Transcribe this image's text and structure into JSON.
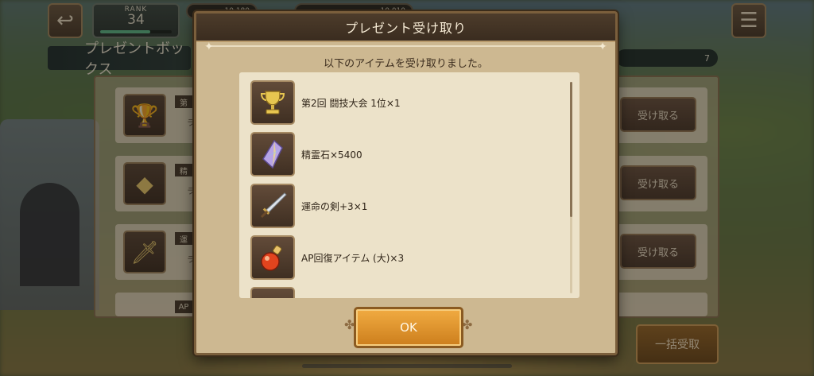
{
  "hud": {
    "back_icon": "return-arrow-icon",
    "rank_label": "RANK",
    "rank_value": "34",
    "res1": "10,180",
    "res2": "10,010",
    "menu_icon": "hamburger-menu-icon"
  },
  "panel": {
    "title": "プレゼントボックス",
    "count": "7",
    "rows": [
      {
        "tag": "第",
        "sub": "ラ",
        "button": "受け取る",
        "icon": "trophy-icon"
      },
      {
        "tag": "精",
        "sub": "ラ",
        "button": "受け取る",
        "icon": "crystal-icon"
      },
      {
        "tag": "運",
        "sub": "ラ",
        "button": "受け取る",
        "icon": "sword-icon"
      },
      {
        "tag": "AP",
        "sub": "",
        "button": "",
        "icon": "sword-icon"
      }
    ],
    "bulk_button": "一括受取"
  },
  "modal": {
    "title": "プレゼント受け取り",
    "message": "以下のアイテムを受け取りました。",
    "items": [
      {
        "name": "第2回 闘技大会 1位×1",
        "icon": "trophy-icon"
      },
      {
        "name": "精霊石×5400",
        "icon": "crystal-icon"
      },
      {
        "name": "運命の剣+3×1",
        "icon": "sword-icon"
      },
      {
        "name": "AP回復アイテム (大)×3",
        "icon": "potion-icon"
      },
      {
        "name": "",
        "icon": "item-icon"
      }
    ],
    "ok_label": "OK"
  },
  "colors": {
    "modal_bg": "#cdb891",
    "header_bg": "#3a2c1f",
    "ok_button": "#e79a30"
  }
}
